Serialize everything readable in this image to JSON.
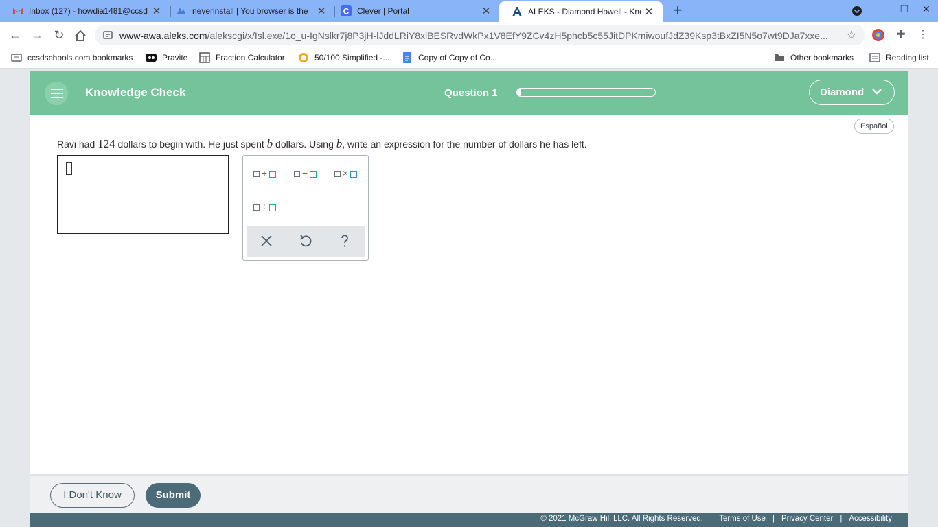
{
  "browser": {
    "tabs": [
      {
        "title": "Inbox (127) - howdia1481@ccsd",
        "icon": "gmail-icon",
        "active": false
      },
      {
        "title": "neverinstall | You browser is the",
        "icon": "neverinstall-icon",
        "active": false
      },
      {
        "title": "Clever | Portal",
        "icon": "clever-icon",
        "active": false
      },
      {
        "title": "ALEKS - Diamond Howell - Know",
        "icon": "aleks-icon",
        "active": true
      }
    ],
    "url_domain": "www-awa.aleks.com",
    "url_path": "/alekscgi/x/Isl.exe/1o_u-IgNslkr7j8P3jH-lJddLRiY8xlBESRvdWkPx1V8EfY9ZCv4zH5phcb5c55JitDPKmiwoufJdZ39Ksp3tBxZI5N5o7wt9DJa7xxe...",
    "bookmarks": [
      {
        "label": "ccsdschools.com bookmarks",
        "icon": "bookmark-folder-icon"
      },
      {
        "label": "Pravite",
        "icon": "pravite-icon"
      },
      {
        "label": "Fraction Calculator",
        "icon": "calculator-icon"
      },
      {
        "label": "50/100 Simplified -...",
        "icon": "simplified-icon"
      },
      {
        "label": "Copy of Copy of Co...",
        "icon": "docs-icon"
      }
    ],
    "other_bookmarks": "Other bookmarks",
    "reading_list": "Reading list"
  },
  "app": {
    "title": "Knowledge Check",
    "question_label": "Question 1",
    "progress": 0.03,
    "user_name": "Diamond",
    "language_button": "Español",
    "question": {
      "part1": "Ravi had ",
      "amount": "124",
      "part2": " dollars to begin with. He just spent ",
      "var": "b",
      "part3": " dollars. Using ",
      "var2": "b",
      "part4": ", write an expression for the number of dollars he has left."
    },
    "keypad": {
      "keys": [
        {
          "op": "+",
          "name": "add-template-key"
        },
        {
          "op": "−",
          "name": "subtract-template-key"
        },
        {
          "op": "×",
          "name": "multiply-template-key"
        },
        {
          "op": "÷",
          "name": "divide-template-key"
        }
      ],
      "actions": [
        "clear",
        "undo",
        "help"
      ]
    },
    "footer": {
      "idk_label": "I Don't Know",
      "submit_label": "Submit",
      "copyright": "© 2021 McGraw Hill LLC. All Rights Reserved.",
      "links": [
        "Terms of Use",
        "Privacy Center",
        "Accessibility"
      ]
    }
  },
  "colors": {
    "header_green": "#74c39a",
    "footer_slate": "#4c6b79",
    "template_teal": "#19a3b4"
  }
}
